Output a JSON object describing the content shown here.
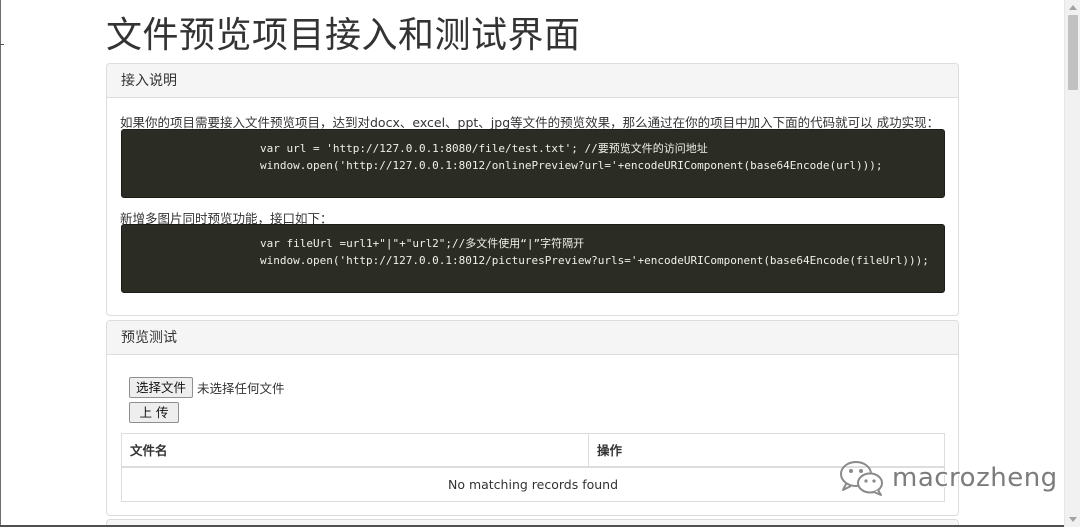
{
  "page": {
    "title": "文件预览项目接入和测试界面"
  },
  "intro_panel": {
    "heading": "接入说明",
    "description": "如果你的项目需要接入文件预览项目，达到对docx、excel、ppt、jpg等文件的预览效果，那么通过在你的项目中加入下面的代码就可以 成功实现：",
    "code_1_line_1": "var url = 'http://127.0.0.1:8080/file/test.txt'; //要预览文件的访问地址",
    "code_1_line_2": "window.open('http://127.0.0.1:8012/onlinePreview?url='+encodeURIComponent(base64Encode(url)));",
    "multi_description": "新增多图片同时预览功能，接口如下：",
    "code_2_line_1": "var fileUrl =url1+\"|\"+\"url2\";//多文件使用“|”字符隔开",
    "code_2_line_2": "window.open('http://127.0.0.1:8012/picturesPreview?urls='+encodeURIComponent(base64Encode(fileUrl)));"
  },
  "test_panel": {
    "heading": "预览测试",
    "choose_file_label": "选择文件",
    "file_status": "未选择任何文件",
    "upload_label": "上 传",
    "table": {
      "columns": [
        "文件名",
        "操作"
      ],
      "empty_message": "No matching records found"
    }
  },
  "watermark": {
    "text": "macrozheng",
    "icon": "wechat-logo-icon"
  },
  "scrollbar": {
    "icon_up": "scroll-up-arrow-icon",
    "icon_down": "scroll-down-arrow-icon"
  }
}
